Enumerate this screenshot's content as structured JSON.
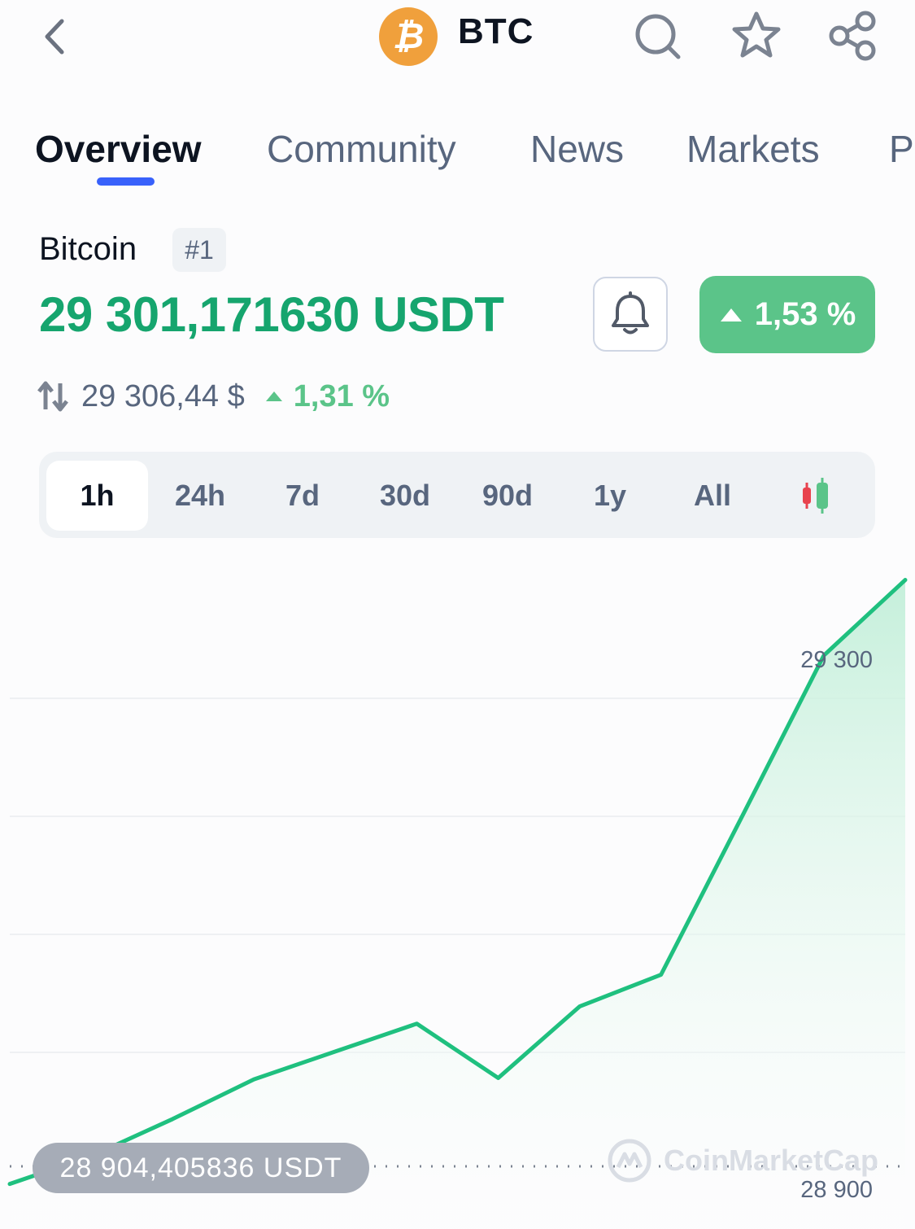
{
  "header": {
    "symbol": "BTC",
    "coin_logo_glyph": "₿",
    "icons": [
      "back-icon",
      "search-icon",
      "star-icon",
      "share-icon"
    ]
  },
  "tabs": [
    {
      "label": "Overview",
      "active": true
    },
    {
      "label": "Community"
    },
    {
      "label": "News"
    },
    {
      "label": "Markets"
    },
    {
      "label": "P"
    }
  ],
  "coin": {
    "name": "Bitcoin",
    "rank": "#1",
    "price": "29 301,171630 USDT",
    "change_24h": "1,53 %",
    "usd_price": "29 306,44 $",
    "usd_change": "1,31 %"
  },
  "ranges": {
    "items": [
      "1h",
      "24h",
      "7d",
      "30d",
      "90d",
      "1y",
      "All"
    ],
    "selected": "1h"
  },
  "chart": {
    "low_tag": "28 904,405836  USDT",
    "watermark": "CoinMarketCap",
    "colors": {
      "line": "#1fc07f",
      "fill": "#d5f2e4",
      "accent": "#3861fb",
      "up": "#5bc489"
    }
  },
  "chart_data": {
    "type": "area",
    "x": [
      0,
      1,
      2,
      3,
      4,
      5,
      6,
      7,
      8,
      9,
      10,
      11
    ],
    "y": [
      28904,
      28925,
      28953,
      28983,
      29004,
      29025,
      28984,
      29038,
      29062,
      29182,
      29303,
      29360
    ],
    "yticks": [
      "29 300",
      "28 900"
    ],
    "ylim": [
      28870,
      29380
    ],
    "grid": true
  }
}
